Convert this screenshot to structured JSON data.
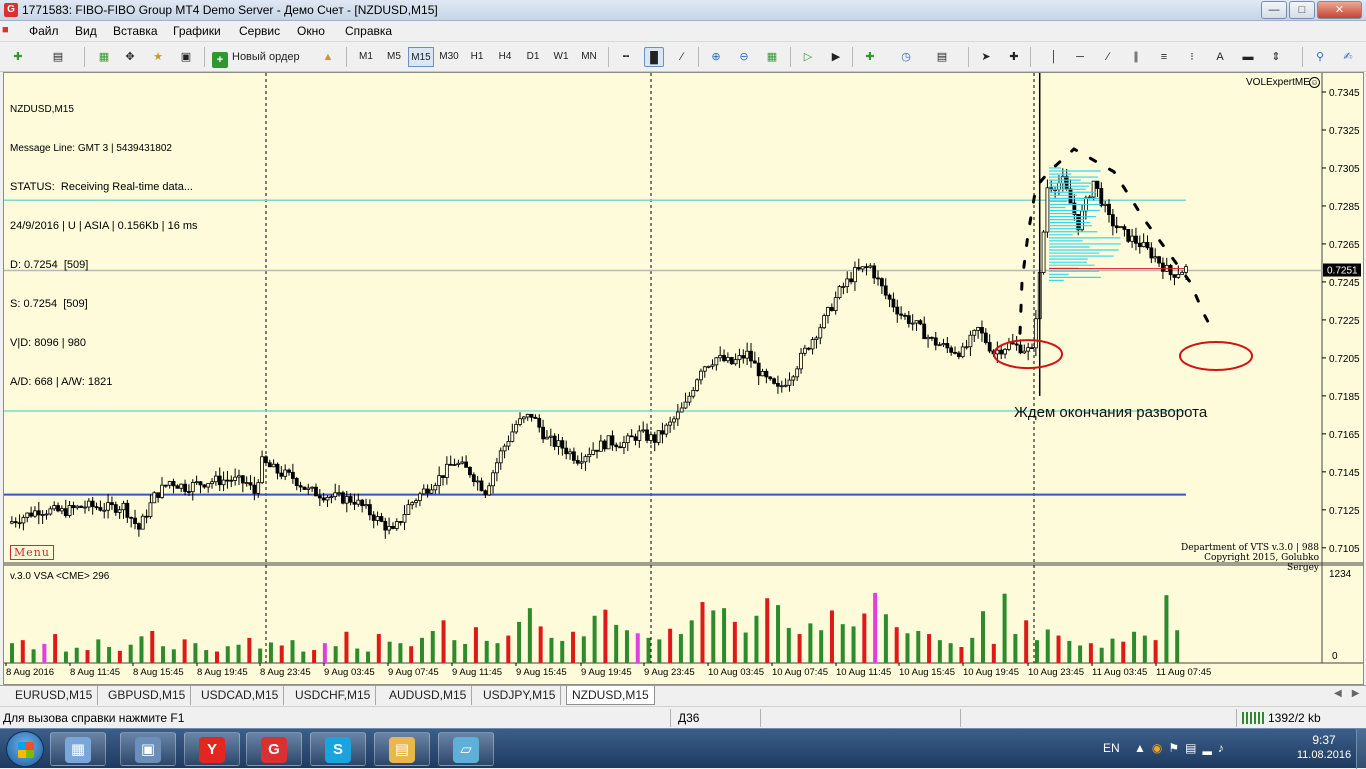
{
  "window": {
    "title": "1771583: FIBO-FIBO Group MT4 Demo Server - Демо Счет - [NZDUSD,M15]",
    "app_icon": "G",
    "minimize_icon": "minimize-icon",
    "maximize_icon": "maximize-icon",
    "close_icon": "close-icon"
  },
  "menu": {
    "items": [
      "Файл",
      "Вид",
      "Вставка",
      "Графики",
      "Сервис",
      "Окно",
      "Справка"
    ]
  },
  "toolbar": {
    "new_order_label": "Новый ордер",
    "timeframes": [
      "M1",
      "M5",
      "M15",
      "M30",
      "H1",
      "H4",
      "D1",
      "W1",
      "MN"
    ],
    "active_timeframe": "M15",
    "text_tool_label": "A"
  },
  "chart": {
    "info_lines": [
      "NZDUSD,M15",
      "Message Line: GMT 3 | 5439431802",
      "STATUS:  Receiving Real-time data...",
      "24/9/2016 | U | ASIA | 0.156Kb | 16 ms",
      "D: 0.7254  [509]",
      "S: 0.7254  [509]",
      "V|D: 8096 | 980",
      "A/D: 668 | A/W: 1821"
    ],
    "expert_name": "VOLExpertME",
    "expert_smile": "☺",
    "menu_button": "Menu",
    "copyright_lines": [
      "Department of VTS  v.3.0 | 988",
      "Copyright 2015, Golubko Sergey"
    ],
    "annotation": "Ждем окончания разворота",
    "volume_label": "v.3.0 VSA <CME> 296",
    "current_price": "0.7251",
    "current_price_value": 0.7251,
    "volume_max_label": "1234",
    "volume_min_label": "0",
    "price_axis": {
      "ticks": [
        "0.7345",
        "0.7325",
        "0.7305",
        "0.7285",
        "0.7265",
        "0.7245",
        "0.7225",
        "0.7205",
        "0.7185",
        "0.7165",
        "0.7145",
        "0.7125",
        "0.7105"
      ],
      "max": 0.7355,
      "min": 0.7097
    },
    "time_axis": {
      "labels": [
        "8 Aug 2016",
        "8 Aug 11:45",
        "8 Aug 15:45",
        "8 Aug 19:45",
        "8 Aug 23:45",
        "9 Aug 03:45",
        "9 Aug 07:45",
        "9 Aug 11:45",
        "9 Aug 15:45",
        "9 Aug 19:45",
        "9 Aug 23:45",
        "10 Aug 03:45",
        "10 Aug 07:45",
        "10 Aug 11:45",
        "10 Aug 15:45",
        "10 Aug 19:45",
        "10 Aug 23:45",
        "11 Aug 03:45",
        "11 Aug 07:45"
      ]
    },
    "horizontal_levels": [
      {
        "price": 0.7288,
        "color": "#7fd8d0"
      },
      {
        "price": 0.7177,
        "color": "#7fd8d0"
      },
      {
        "price": 0.7133,
        "color": "#3b53c4"
      },
      {
        "price": 0.7251,
        "color": "#b8b8b8"
      }
    ],
    "colors": {
      "background": "#fdfbd9",
      "candle": "#000000",
      "volume_up": "#2d8b2d",
      "volume_down": "#e01818",
      "volume_special": "#e040e0",
      "profile": "#35d7f0",
      "ellipse": "#d01414"
    }
  },
  "chart_data": {
    "type": "candlestick",
    "symbol": "NZDUSD",
    "timeframe": "M15",
    "close_path": [
      [
        0,
        0.7118
      ],
      [
        8,
        0.7125
      ],
      [
        14,
        0.7124
      ],
      [
        20,
        0.7127
      ],
      [
        26,
        0.7126
      ],
      [
        30,
        0.7127
      ],
      [
        34,
        0.7115
      ],
      [
        38,
        0.7132
      ],
      [
        42,
        0.714
      ],
      [
        46,
        0.7137
      ],
      [
        52,
        0.714
      ],
      [
        58,
        0.7141
      ],
      [
        62,
        0.7139
      ],
      [
        64,
        0.7134
      ],
      [
        66,
        0.715
      ],
      [
        70,
        0.7145
      ],
      [
        74,
        0.7142
      ],
      [
        78,
        0.7135
      ],
      [
        84,
        0.7132
      ],
      [
        90,
        0.713
      ],
      [
        96,
        0.712
      ],
      [
        100,
        0.7113
      ],
      [
        104,
        0.7127
      ],
      [
        108,
        0.7135
      ],
      [
        112,
        0.7142
      ],
      [
        116,
        0.715
      ],
      [
        120,
        0.7145
      ],
      [
        124,
        0.7135
      ],
      [
        128,
        0.7155
      ],
      [
        132,
        0.717
      ],
      [
        136,
        0.7175
      ],
      [
        140,
        0.7162
      ],
      [
        144,
        0.7158
      ],
      [
        148,
        0.7152
      ],
      [
        152,
        0.7157
      ],
      [
        156,
        0.7161
      ],
      [
        160,
        0.716
      ],
      [
        164,
        0.7165
      ],
      [
        168,
        0.7162
      ],
      [
        172,
        0.717
      ],
      [
        176,
        0.718
      ],
      [
        180,
        0.72
      ],
      [
        184,
        0.7205
      ],
      [
        188,
        0.7202
      ],
      [
        192,
        0.7207
      ],
      [
        196,
        0.7195
      ],
      [
        200,
        0.7188
      ],
      [
        204,
        0.7198
      ],
      [
        208,
        0.7212
      ],
      [
        212,
        0.7225
      ],
      [
        216,
        0.724
      ],
      [
        220,
        0.725
      ],
      [
        224,
        0.7253
      ],
      [
        228,
        0.7238
      ],
      [
        232,
        0.7228
      ],
      [
        236,
        0.7222
      ],
      [
        240,
        0.7214
      ],
      [
        244,
        0.721
      ],
      [
        248,
        0.7208
      ],
      [
        252,
        0.722
      ],
      [
        256,
        0.7208
      ],
      [
        260,
        0.7212
      ],
      [
        264,
        0.721
      ],
      [
        266,
        0.7208
      ],
      [
        268,
        0.7248
      ],
      [
        270,
        0.7295
      ],
      [
        274,
        0.7298
      ],
      [
        278,
        0.7275
      ],
      [
        282,
        0.7298
      ],
      [
        286,
        0.7278
      ],
      [
        290,
        0.727
      ],
      [
        294,
        0.7265
      ],
      [
        298,
        0.7258
      ],
      [
        302,
        0.7249
      ],
      [
        306,
        0.7252
      ]
    ],
    "volumes": [
      260,
      300,
      180,
      250,
      380,
      150,
      200,
      170,
      310,
      210,
      160,
      240,
      350,
      420,
      220,
      180,
      310,
      260,
      170,
      150,
      220,
      240,
      330,
      190,
      270,
      230,
      300,
      150,
      170,
      260,
      220,
      410,
      190,
      150,
      380,
      280,
      260,
      220,
      330,
      420,
      560,
      300,
      250,
      470,
      290,
      260,
      360,
      540,
      720,
      480,
      330,
      290,
      410,
      350,
      620,
      700,
      500,
      430,
      390,
      330,
      310,
      450,
      380,
      560,
      800,
      690,
      720,
      540,
      400,
      620,
      850,
      760,
      460,
      380,
      520,
      430,
      690,
      510,
      480,
      650,
      920,
      640,
      470,
      390,
      420,
      380,
      300,
      260,
      210,
      330,
      680,
      250,
      910,
      380,
      560,
      300,
      440,
      360,
      290,
      230,
      260,
      200,
      320,
      280,
      410,
      360,
      300,
      890,
      430
    ],
    "ellipses_price": [
      0.7207,
      0.7206
    ]
  },
  "tabs": [
    "EURUSD,M15",
    "GBPUSD,M15",
    "USDCAD,M15",
    "USDCHF,M15",
    "AUDUSD,M15",
    "USDJPY,M15",
    "NZDUSD,M15"
  ],
  "active_tab": "NZDUSD,M15",
  "status": {
    "help": "Для вызова справки нажмите F1",
    "profile": "Д36",
    "traffic": "1392/2 kb"
  },
  "taskbar": {
    "apps": [
      {
        "name": "calculator",
        "icon": "calculator-icon",
        "glyph": "▦",
        "color": "#7aa7d8"
      },
      {
        "name": "computer",
        "icon": "computer-icon",
        "glyph": "▣",
        "color": "#6b8fb8"
      },
      {
        "name": "yandex",
        "icon": "yandex-icon",
        "glyph": "Y",
        "color": "#e52620"
      },
      {
        "name": "fibo",
        "icon": "fibo-icon",
        "glyph": "G",
        "color": "#d8312f"
      },
      {
        "name": "skype",
        "icon": "skype-icon",
        "glyph": "S",
        "color": "#1ba3e0"
      },
      {
        "name": "explorer",
        "icon": "folder-icon",
        "glyph": "▤",
        "color": "#e8b84a"
      },
      {
        "name": "notes",
        "icon": "notes-icon",
        "glyph": "▱",
        "color": "#5fb0d8"
      }
    ],
    "lang": "EN",
    "time": "9:37",
    "date": "11.08.2016"
  }
}
